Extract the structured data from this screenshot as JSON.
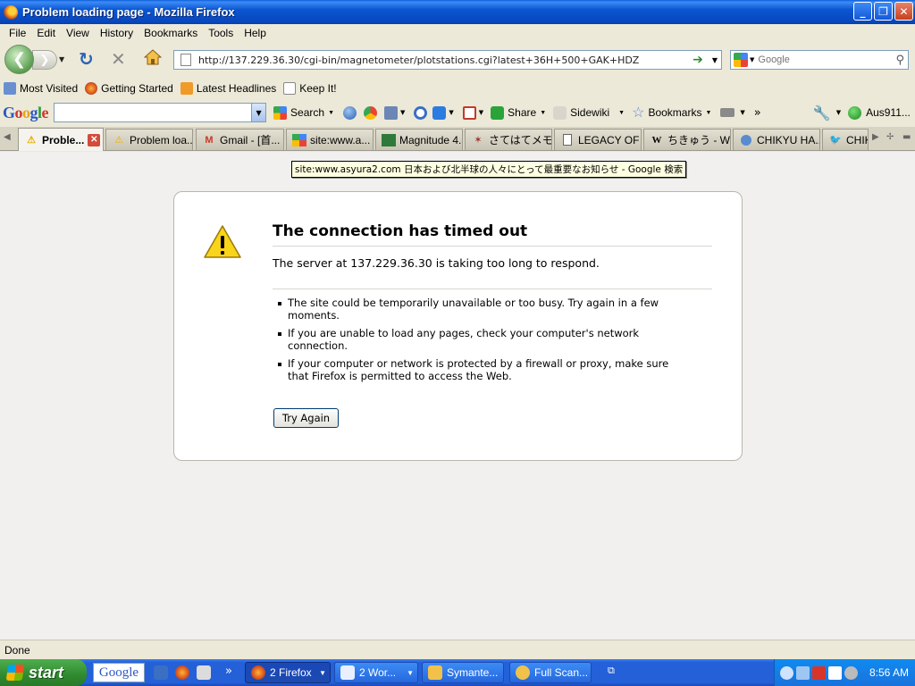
{
  "window": {
    "title": "Problem loading page - Mozilla Firefox"
  },
  "menu": [
    "File",
    "Edit",
    "View",
    "History",
    "Bookmarks",
    "Tools",
    "Help"
  ],
  "navbar": {
    "url": "http://137.229.36.30/cgi-bin/magnetometer/plotstations.cgi?latest+36H+500+GAK+HDZ",
    "search_placeholder": "Google"
  },
  "bookmarks": [
    "Most Visited",
    "Getting Started",
    "Latest Headlines",
    "Keep It!"
  ],
  "google_toolbar": {
    "logo": "Google",
    "search_label": "Search",
    "share_label": "Share",
    "sidewiki_label": "Sidewiki",
    "bookmarks_label": "Bookmarks",
    "more": "»",
    "account": "Aus911..."
  },
  "tabs": [
    {
      "label": "Proble...",
      "active": true
    },
    {
      "label": "Problem loa...",
      "active": false
    },
    {
      "label": "Gmail - [首...",
      "active": false
    },
    {
      "label": "site:www.a...",
      "active": false
    },
    {
      "label": "Magnitude 4...",
      "active": false
    },
    {
      "label": "さてはてメモ...",
      "active": false
    },
    {
      "label": "LEGACY OF ...",
      "active": false
    },
    {
      "label": "ちきゅう - Wi...",
      "active": false
    },
    {
      "label": "CHIKYU HA...",
      "active": false
    },
    {
      "label": "CHIK",
      "active": false
    }
  ],
  "tooltip": "site:www.asyura2.com 日本および北半球の人々にとって最重要なお知らせ - Google 検索",
  "error": {
    "title": "The connection has timed out",
    "description": "The server at 137.229.36.30 is taking too long to respond.",
    "items": [
      "The site could be temporarily unavailable or too busy. Try again in a few moments.",
      "If you are unable to load any pages, check your computer's network connection.",
      "If your computer or network is protected by a firewall or proxy, make sure that Firefox is permitted to access the Web."
    ],
    "button": "Try Again"
  },
  "status": "Done",
  "taskbar": {
    "start": "start",
    "google": "Google",
    "more": "»",
    "tasks": [
      {
        "label": "2 Firefox",
        "active": true
      },
      {
        "label": "2 Wor...",
        "active": false
      },
      {
        "label": "Symante...",
        "active": false
      },
      {
        "label": "Full Scan...",
        "active": false
      }
    ],
    "clock": "8:56 AM"
  }
}
